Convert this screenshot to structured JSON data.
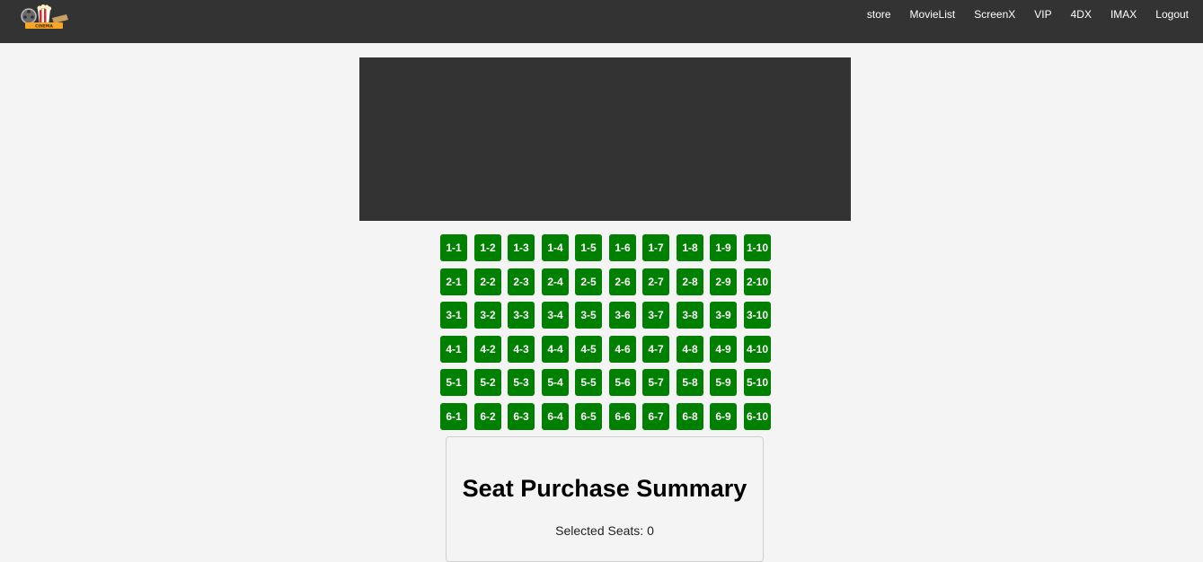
{
  "nav": {
    "logo_text": "CINEMA",
    "links": [
      "store",
      "MovieList",
      "ScreenX",
      "VIP",
      "4DX",
      "IMAX",
      "Logout"
    ]
  },
  "colors": {
    "navbar": "#333333",
    "screen": "#333333",
    "seat_available": "#008000",
    "background": "#f4f4f4"
  },
  "seats": {
    "rows": [
      [
        "1-1",
        "1-2",
        "1-3",
        "1-4",
        "1-5",
        "1-6",
        "1-7",
        "1-8",
        "1-9",
        "1-10"
      ],
      [
        "2-1",
        "2-2",
        "2-3",
        "2-4",
        "2-5",
        "2-6",
        "2-7",
        "2-8",
        "2-9",
        "2-10"
      ],
      [
        "3-1",
        "3-2",
        "3-3",
        "3-4",
        "3-5",
        "3-6",
        "3-7",
        "3-8",
        "3-9",
        "3-10"
      ],
      [
        "4-1",
        "4-2",
        "4-3",
        "4-4",
        "4-5",
        "4-6",
        "4-7",
        "4-8",
        "4-9",
        "4-10"
      ],
      [
        "5-1",
        "5-2",
        "5-3",
        "5-4",
        "5-5",
        "5-6",
        "5-7",
        "5-8",
        "5-9",
        "5-10"
      ],
      [
        "6-1",
        "6-2",
        "6-3",
        "6-4",
        "6-5",
        "6-6",
        "6-7",
        "6-8",
        "6-9",
        "6-10"
      ]
    ]
  },
  "summary": {
    "title": "Seat Purchase Summary",
    "selected_label": "Selected Seats: ",
    "selected_count": "0"
  }
}
